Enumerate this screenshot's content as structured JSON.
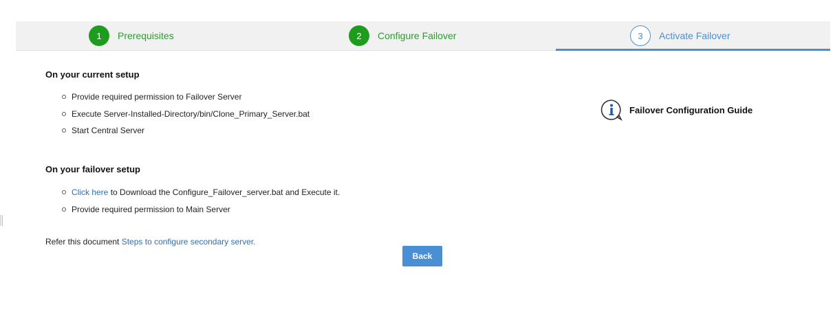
{
  "stepper": {
    "steps": [
      {
        "number": "1",
        "label": "Prerequisites",
        "state": "completed"
      },
      {
        "number": "2",
        "label": "Configure Failover",
        "state": "completed"
      },
      {
        "number": "3",
        "label": "Activate Failover",
        "state": "active"
      }
    ]
  },
  "current_setup": {
    "title": "On your current setup",
    "items": [
      "Provide required permission to Failover Server",
      "Execute Server-Installed-Directory/bin/Clone_Primary_Server.bat",
      "Start Central Server"
    ]
  },
  "failover_setup": {
    "title": "On your failover setup",
    "item1_link": "Click here",
    "item1_text": " to Download the Configure_Failover_server.bat and Execute it.",
    "item2": "Provide required permission to Main Server"
  },
  "refer": {
    "prefix": "Refer this document ",
    "link": "Steps to configure secondary server."
  },
  "back_button": "Back",
  "guide": {
    "label": "Failover Configuration Guide",
    "icon": "info-icon"
  },
  "colors": {
    "completed_green": "#1e9c1e",
    "active_blue": "#4b8fd0",
    "link_blue": "#2e6fb0",
    "button_blue": "#4a8fd4",
    "stepper_bg": "#f1f1f1"
  }
}
